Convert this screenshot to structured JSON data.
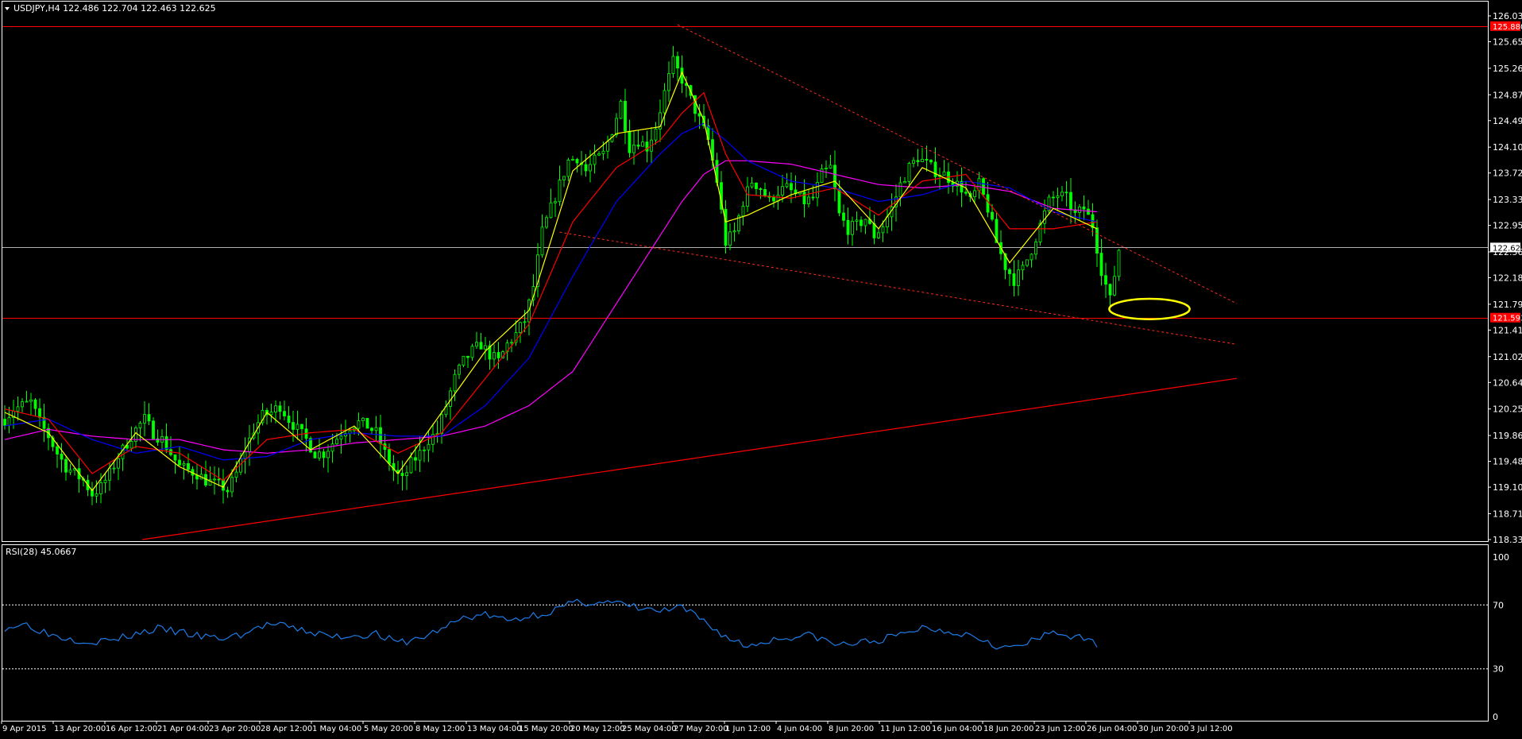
{
  "window": {
    "symbol_header": "USDJPY,H4  122.486 122.704 122.463 122.625",
    "rsi_header": "RSI(28) 45.0667"
  },
  "colors": {
    "background": "#000000",
    "frame": "#ffffff",
    "candle_up": "#00ff00",
    "candle_down": "#00ff00",
    "ma_fast": "#ffff00",
    "ma_mid": "#ff0000",
    "ma_slow_a": "#0000ff",
    "ma_slow_b": "#ff00ff",
    "support_resistance": "#ff0000",
    "trendline_dotted": "#ff2a1a",
    "current_price_line": "#b0b0b0",
    "ellipse": "#ffff00",
    "rsi_line": "#1e7be6",
    "rsi_levels": "#ffffff"
  },
  "chart_data": [
    {
      "type": "candlestick",
      "title": "USDJPY,H4",
      "ohlc_last": {
        "open": 122.486,
        "high": 122.704,
        "low": 122.463,
        "close": 122.625
      },
      "ylim": [
        118.33,
        126.21
      ],
      "y_ticks": [
        "126.030",
        "125.650",
        "125.260",
        "124.870",
        "124.490",
        "124.100",
        "123.720",
        "123.330",
        "122.950",
        "122.560",
        "122.180",
        "121.790",
        "121.410",
        "121.020",
        "120.640",
        "120.250",
        "119.860",
        "119.480",
        "119.100",
        "118.710",
        "118.330"
      ],
      "x_labels": [
        "9 Apr 2015",
        "13 Apr 20:00",
        "16 Apr 12:00",
        "21 Apr 04:00",
        "23 Apr 20:00",
        "28 Apr 12:00",
        "1 May 04:00",
        "5 May 20:00",
        "8 May 12:00",
        "13 May 04:00",
        "15 May 20:00",
        "20 May 12:00",
        "25 May 04:00",
        "27 May 20:00",
        "1 Jun 12:00",
        "4 Jun 04:00",
        "8 Jun 20:00",
        "11 Jun 12:00",
        "16 Jun 04:00",
        "18 Jun 20:00",
        "23 Jun 12:00",
        "26 Jun 04:00",
        "30 Jun 20:00",
        "3 Jul 12:00"
      ],
      "price_boxes": [
        {
          "label": "125.880",
          "value": 125.88,
          "style": "red"
        },
        {
          "label": "122.625",
          "value": 122.625,
          "style": "white"
        },
        {
          "label": "121.593",
          "value": 121.593,
          "style": "red"
        }
      ],
      "horizontal_lines": [
        {
          "value": 125.88,
          "color": "red"
        },
        {
          "value": 122.625,
          "color": "gray"
        },
        {
          "value": 121.593,
          "color": "red"
        }
      ],
      "price_anchors": [
        [
          0,
          120.1
        ],
        [
          2,
          120.25
        ],
        [
          4,
          120.3
        ],
        [
          6,
          120.35
        ],
        [
          8,
          120.05
        ],
        [
          10,
          119.85
        ],
        [
          12,
          119.6
        ],
        [
          14,
          119.4
        ],
        [
          16,
          119.3
        ],
        [
          18,
          119.2
        ],
        [
          20,
          119.0
        ],
        [
          22,
          119.1
        ],
        [
          24,
          119.3
        ],
        [
          26,
          119.55
        ],
        [
          28,
          119.75
        ],
        [
          30,
          119.95
        ],
        [
          32,
          120.1
        ],
        [
          34,
          119.9
        ],
        [
          36,
          119.8
        ],
        [
          38,
          119.6
        ],
        [
          40,
          119.4
        ],
        [
          42,
          119.35
        ],
        [
          44,
          119.3
        ],
        [
          46,
          119.2
        ],
        [
          48,
          119.15
        ],
        [
          50,
          119.1
        ],
        [
          51,
          119.05
        ],
        [
          53,
          119.3
        ],
        [
          55,
          119.65
        ],
        [
          57,
          119.95
        ],
        [
          59,
          120.15
        ],
        [
          61,
          120.2
        ],
        [
          63,
          120.3
        ],
        [
          65,
          120.1
        ],
        [
          67,
          119.95
        ],
        [
          69,
          119.8
        ],
        [
          71,
          119.6
        ],
        [
          73,
          119.6
        ],
        [
          75,
          119.75
        ],
        [
          77,
          119.9
        ],
        [
          79,
          120.0
        ],
        [
          81,
          120.05
        ],
        [
          83,
          120.0
        ],
        [
          85,
          119.9
        ],
        [
          87,
          119.6
        ],
        [
          89,
          119.35
        ],
        [
          91,
          119.2
        ],
        [
          93,
          119.45
        ],
        [
          95,
          119.6
        ],
        [
          97,
          119.8
        ],
        [
          99,
          119.9
        ],
        [
          101,
          120.3
        ],
        [
          103,
          120.7
        ],
        [
          105,
          120.95
        ],
        [
          107,
          121.1
        ],
        [
          109,
          121.2
        ],
        [
          111,
          121.05
        ],
        [
          113,
          120.95
        ],
        [
          115,
          121.2
        ],
        [
          117,
          121.35
        ],
        [
          119,
          121.55
        ],
        [
          121,
          122.05
        ],
        [
          123,
          122.85
        ],
        [
          125,
          123.2
        ],
        [
          127,
          123.55
        ],
        [
          129,
          123.9
        ],
        [
          131,
          123.95
        ],
        [
          133,
          123.75
        ],
        [
          135,
          123.9
        ],
        [
          137,
          124.0
        ],
        [
          139,
          124.35
        ],
        [
          141,
          124.75
        ],
        [
          143,
          124.1
        ],
        [
          145,
          124.2
        ],
        [
          147,
          124.1
        ],
        [
          149,
          124.4
        ],
        [
          151,
          124.9
        ],
        [
          153,
          125.35
        ],
        [
          155,
          125.1
        ],
        [
          157,
          124.8
        ],
        [
          159,
          124.5
        ],
        [
          161,
          124.2
        ],
        [
          163,
          123.6
        ],
        [
          165,
          122.7
        ],
        [
          167,
          122.85
        ],
        [
          169,
          123.3
        ],
        [
          171,
          123.6
        ],
        [
          173,
          123.5
        ],
        [
          175,
          123.3
        ],
        [
          177,
          123.45
        ],
        [
          179,
          123.5
        ],
        [
          181,
          123.4
        ],
        [
          183,
          123.3
        ],
        [
          185,
          123.35
        ],
        [
          187,
          123.7
        ],
        [
          189,
          123.8
        ],
        [
          191,
          123.1
        ],
        [
          193,
          122.9
        ],
        [
          195,
          122.95
        ],
        [
          197,
          123.05
        ],
        [
          199,
          122.8
        ],
        [
          201,
          122.95
        ],
        [
          203,
          123.2
        ],
        [
          205,
          123.55
        ],
        [
          207,
          123.8
        ],
        [
          209,
          123.95
        ],
        [
          211,
          123.85
        ],
        [
          213,
          123.75
        ],
        [
          215,
          123.7
        ],
        [
          217,
          123.6
        ],
        [
          219,
          123.5
        ],
        [
          221,
          123.3
        ],
        [
          223,
          123.55
        ],
        [
          225,
          123.2
        ],
        [
          227,
          122.7
        ],
        [
          229,
          122.35
        ],
        [
          231,
          122.15
        ],
        [
          233,
          122.3
        ],
        [
          235,
          122.6
        ],
        [
          237,
          122.95
        ],
        [
          239,
          123.3
        ],
        [
          241,
          123.4
        ],
        [
          243,
          123.35
        ],
        [
          245,
          123.1
        ],
        [
          247,
          123.2
        ],
        [
          249,
          122.95
        ],
        [
          251,
          122.3
        ],
        [
          253,
          121.85
        ],
        [
          255,
          122.6
        ]
      ],
      "ma_fast": [
        [
          0,
          120.2
        ],
        [
          10,
          119.9
        ],
        [
          20,
          119.05
        ],
        [
          30,
          119.9
        ],
        [
          40,
          119.4
        ],
        [
          50,
          119.1
        ],
        [
          60,
          120.2
        ],
        [
          70,
          119.65
        ],
        [
          80,
          120.0
        ],
        [
          90,
          119.3
        ],
        [
          100,
          120.2
        ],
        [
          110,
          121.1
        ],
        [
          120,
          121.7
        ],
        [
          130,
          123.75
        ],
        [
          140,
          124.3
        ],
        [
          150,
          124.4
        ],
        [
          155,
          125.2
        ],
        [
          160,
          124.5
        ],
        [
          165,
          123.0
        ],
        [
          170,
          123.1
        ],
        [
          180,
          123.4
        ],
        [
          190,
          123.6
        ],
        [
          200,
          122.9
        ],
        [
          210,
          123.8
        ],
        [
          220,
          123.5
        ],
        [
          230,
          122.4
        ],
        [
          240,
          123.2
        ],
        [
          250,
          122.9
        ]
      ],
      "ma_mid": [
        [
          0,
          120.25
        ],
        [
          10,
          120.1
        ],
        [
          20,
          119.3
        ],
        [
          30,
          119.7
        ],
        [
          40,
          119.6
        ],
        [
          50,
          119.2
        ],
        [
          60,
          119.8
        ],
        [
          70,
          119.9
        ],
        [
          80,
          119.95
        ],
        [
          90,
          119.6
        ],
        [
          100,
          119.9
        ],
        [
          110,
          120.7
        ],
        [
          120,
          121.5
        ],
        [
          130,
          123.0
        ],
        [
          140,
          123.8
        ],
        [
          150,
          124.2
        ],
        [
          155,
          124.6
        ],
        [
          160,
          124.9
        ],
        [
          165,
          124.0
        ],
        [
          170,
          123.4
        ],
        [
          180,
          123.35
        ],
        [
          190,
          123.5
        ],
        [
          200,
          123.1
        ],
        [
          210,
          123.6
        ],
        [
          220,
          123.7
        ],
        [
          230,
          122.9
        ],
        [
          240,
          122.9
        ],
        [
          250,
          123.0
        ]
      ],
      "ma_slow_a": [
        [
          0,
          120.0
        ],
        [
          10,
          120.1
        ],
        [
          20,
          119.8
        ],
        [
          30,
          119.6
        ],
        [
          40,
          119.7
        ],
        [
          50,
          119.5
        ],
        [
          60,
          119.55
        ],
        [
          70,
          119.8
        ],
        [
          80,
          119.9
        ],
        [
          90,
          119.85
        ],
        [
          100,
          119.85
        ],
        [
          110,
          120.3
        ],
        [
          120,
          121.0
        ],
        [
          130,
          122.2
        ],
        [
          140,
          123.3
        ],
        [
          150,
          124.0
        ],
        [
          155,
          124.3
        ],
        [
          160,
          124.45
        ],
        [
          165,
          124.2
        ],
        [
          170,
          123.9
        ],
        [
          180,
          123.6
        ],
        [
          190,
          123.5
        ],
        [
          200,
          123.3
        ],
        [
          210,
          123.4
        ],
        [
          220,
          123.6
        ],
        [
          230,
          123.5
        ],
        [
          240,
          123.15
        ],
        [
          250,
          123.0
        ]
      ],
      "ma_slow_b": [
        [
          0,
          119.8
        ],
        [
          10,
          119.95
        ],
        [
          20,
          119.85
        ],
        [
          30,
          119.8
        ],
        [
          40,
          119.8
        ],
        [
          50,
          119.65
        ],
        [
          60,
          119.6
        ],
        [
          70,
          119.65
        ],
        [
          80,
          119.75
        ],
        [
          90,
          119.8
        ],
        [
          100,
          119.85
        ],
        [
          110,
          120.0
        ],
        [
          120,
          120.3
        ],
        [
          130,
          120.8
        ],
        [
          140,
          121.8
        ],
        [
          150,
          122.8
        ],
        [
          155,
          123.3
        ],
        [
          160,
          123.7
        ],
        [
          165,
          123.9
        ],
        [
          170,
          123.9
        ],
        [
          180,
          123.85
        ],
        [
          190,
          123.7
        ],
        [
          200,
          123.55
        ],
        [
          210,
          123.5
        ],
        [
          220,
          123.55
        ],
        [
          230,
          123.45
        ],
        [
          240,
          123.2
        ],
        [
          250,
          123.15
        ]
      ],
      "trendlines": [
        {
          "style": "solid",
          "from": [
            31.5,
            118.33
          ],
          "to": [
            282,
            120.7
          ]
        },
        {
          "style": "dotted",
          "from": [
            154,
            125.9
          ],
          "to": [
            282,
            121.8
          ]
        },
        {
          "style": "dotted",
          "from": [
            127,
            122.85
          ],
          "to": [
            282,
            121.2
          ]
        }
      ],
      "ellipse": {
        "center": [
          262,
          121.72
        ],
        "rx_bars": 9.2,
        "ry_price": 0.15
      },
      "rsi": {
        "title": "RSI(28) 45.0667",
        "ylim": [
          0,
          100
        ],
        "levels": [
          70,
          30
        ],
        "level_labels": [
          "100",
          "70",
          "30",
          "0"
        ],
        "anchors": [
          [
            0,
            56
          ],
          [
            5,
            58
          ],
          [
            10,
            52
          ],
          [
            15,
            49
          ],
          [
            20,
            47
          ],
          [
            25,
            48
          ],
          [
            30,
            52
          ],
          [
            35,
            55
          ],
          [
            40,
            53
          ],
          [
            45,
            50
          ],
          [
            50,
            49
          ],
          [
            55,
            52
          ],
          [
            60,
            58
          ],
          [
            65,
            56
          ],
          [
            70,
            53
          ],
          [
            75,
            50
          ],
          [
            80,
            51
          ],
          [
            85,
            52
          ],
          [
            90,
            46
          ],
          [
            95,
            49
          ],
          [
            100,
            55
          ],
          [
            105,
            62
          ],
          [
            110,
            64
          ],
          [
            115,
            60
          ],
          [
            120,
            63
          ],
          [
            125,
            66
          ],
          [
            130,
            71
          ],
          [
            135,
            72
          ],
          [
            140,
            71
          ],
          [
            145,
            68
          ],
          [
            150,
            66
          ],
          [
            155,
            68
          ],
          [
            160,
            60
          ],
          [
            165,
            50
          ],
          [
            170,
            44
          ],
          [
            175,
            48
          ],
          [
            180,
            50
          ],
          [
            185,
            51
          ],
          [
            190,
            45
          ],
          [
            195,
            46
          ],
          [
            200,
            48
          ],
          [
            205,
            51
          ],
          [
            210,
            56
          ],
          [
            215,
            54
          ],
          [
            220,
            52
          ],
          [
            225,
            48
          ],
          [
            228,
            43
          ],
          [
            232,
            44
          ],
          [
            236,
            48
          ],
          [
            240,
            53
          ],
          [
            245,
            50
          ],
          [
            248,
            47
          ],
          [
            250,
            46
          ]
        ]
      }
    }
  ]
}
